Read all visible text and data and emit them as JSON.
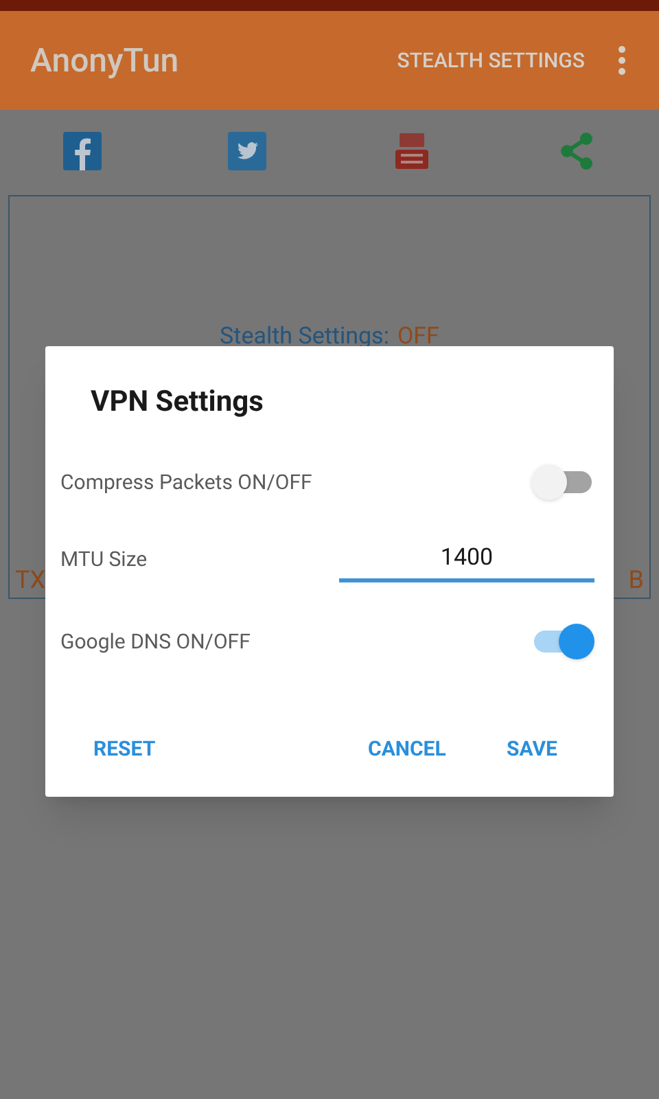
{
  "app_bar": {
    "title": "AnonyTun",
    "action": "STEALTH SETTINGS"
  },
  "status": {
    "label": "Stealth Settings:",
    "value": "OFF"
  },
  "traffic": {
    "left_text": "TX",
    "right_text": "B"
  },
  "dialog": {
    "title": "VPN Settings",
    "rows": [
      {
        "kind": "switch",
        "label": "Compress Packets ON/OFF",
        "on": false
      },
      {
        "kind": "input",
        "label": "MTU Size",
        "value": "1400"
      },
      {
        "kind": "switch",
        "label": "Google DNS ON/OFF",
        "on": true
      }
    ],
    "buttons": [
      "RESET",
      "CANCEL",
      "SAVE"
    ]
  }
}
